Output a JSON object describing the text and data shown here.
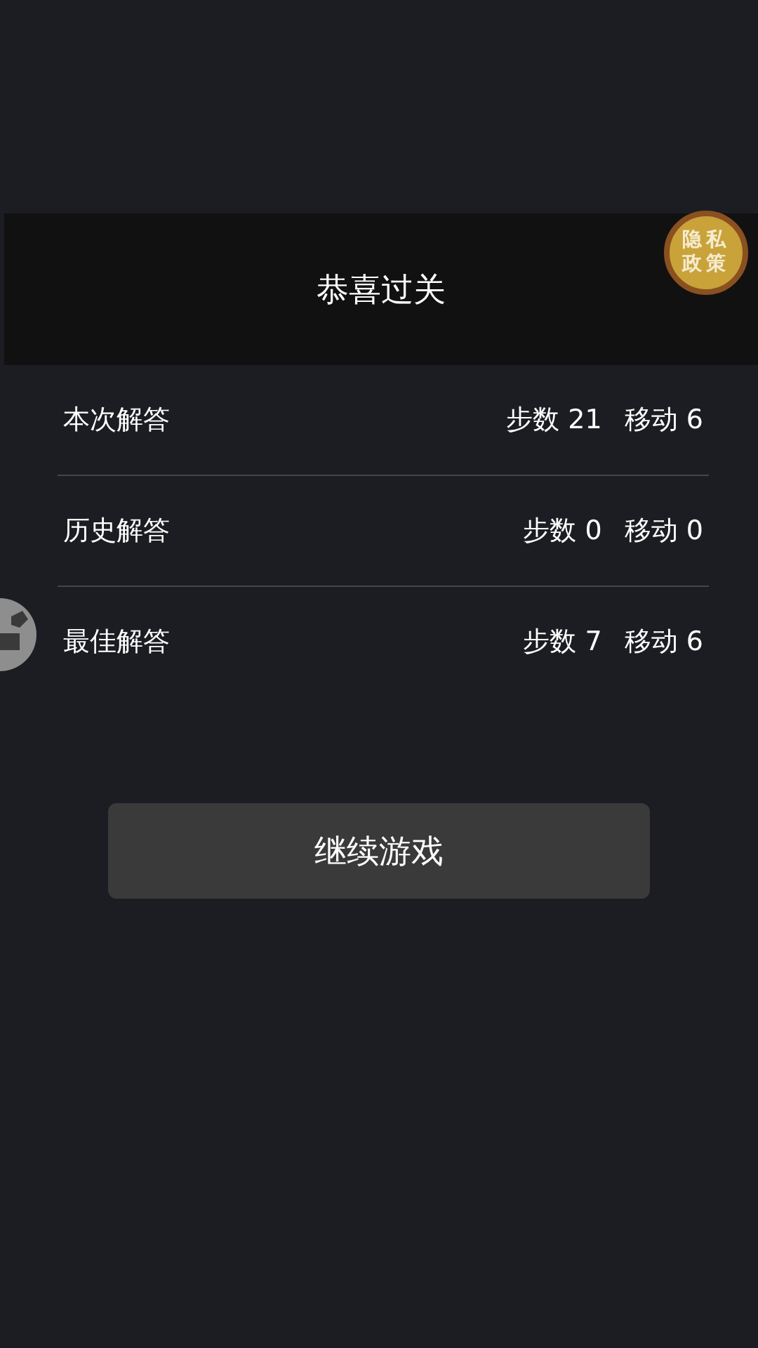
{
  "header": {
    "title": "恭喜过关"
  },
  "privacy_badge": "隐私政策",
  "results": [
    {
      "label": "本次解答",
      "steps": "步数 21",
      "moves": "移动 6"
    },
    {
      "label": "历史解答",
      "steps": "步数 0",
      "moves": "移动 0"
    },
    {
      "label": "最佳解答",
      "steps": "步数 7",
      "moves": "移动 6"
    }
  ],
  "continue_button": "继续游戏"
}
